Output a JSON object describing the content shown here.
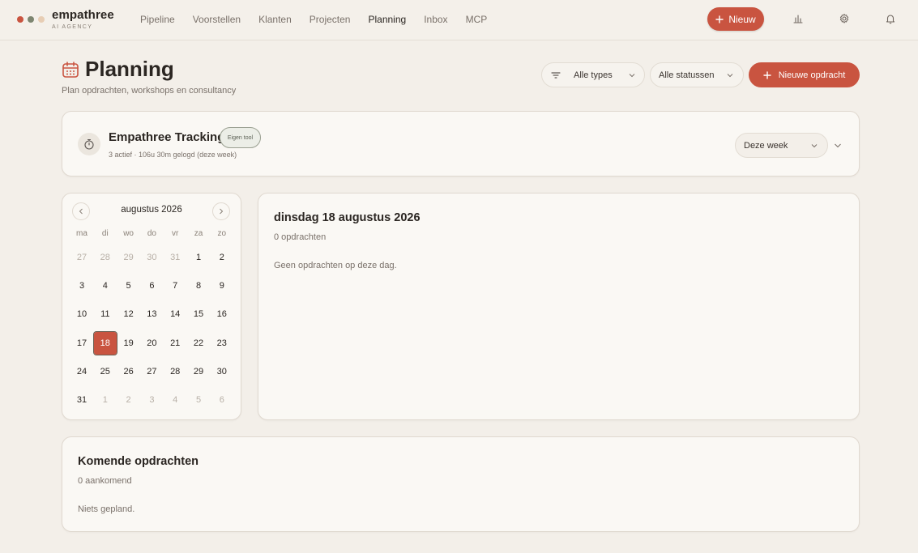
{
  "brand": {
    "name": "empathree",
    "subtitle": "AI AGENCY",
    "dot_colors": [
      "#c95440",
      "#7d8570",
      "#e7cdb4"
    ]
  },
  "nav": {
    "items": [
      {
        "label": "Pipeline",
        "active": false
      },
      {
        "label": "Voorstellen",
        "active": false
      },
      {
        "label": "Klanten",
        "active": false
      },
      {
        "label": "Projecten",
        "active": false
      },
      {
        "label": "Planning",
        "active": true
      },
      {
        "label": "Inbox",
        "active": false
      },
      {
        "label": "MCP",
        "active": false
      }
    ],
    "new_button": "Nieuw",
    "icons": [
      "chart-icon",
      "gear-icon",
      "bell-icon"
    ]
  },
  "header": {
    "title": "Planning",
    "subtitle": "Plan opdrachten, workshops en consultancy",
    "filter_types": "Alle types",
    "filter_status": "Alle statussen",
    "new_assignment": "Nieuwe opdracht"
  },
  "tracking": {
    "title": "Empathree Tracking",
    "badge": "Eigen tool",
    "summary": "3 actief · 106u 30m gelogd (deze week)",
    "period": "Deze week"
  },
  "calendar": {
    "month_label": "augustus 2026",
    "weekdays": [
      "ma",
      "di",
      "wo",
      "do",
      "vr",
      "za",
      "zo"
    ],
    "weeks": [
      [
        {
          "d": "27",
          "m": true
        },
        {
          "d": "28",
          "m": true
        },
        {
          "d": "29",
          "m": true
        },
        {
          "d": "30",
          "m": true
        },
        {
          "d": "31",
          "m": true
        },
        {
          "d": "1"
        },
        {
          "d": "2"
        }
      ],
      [
        {
          "d": "3"
        },
        {
          "d": "4"
        },
        {
          "d": "5"
        },
        {
          "d": "6"
        },
        {
          "d": "7"
        },
        {
          "d": "8"
        },
        {
          "d": "9"
        }
      ],
      [
        {
          "d": "10"
        },
        {
          "d": "11"
        },
        {
          "d": "12"
        },
        {
          "d": "13"
        },
        {
          "d": "14"
        },
        {
          "d": "15"
        },
        {
          "d": "16"
        }
      ],
      [
        {
          "d": "17"
        },
        {
          "d": "18",
          "s": true
        },
        {
          "d": "19"
        },
        {
          "d": "20"
        },
        {
          "d": "21"
        },
        {
          "d": "22"
        },
        {
          "d": "23"
        }
      ],
      [
        {
          "d": "24"
        },
        {
          "d": "25"
        },
        {
          "d": "26"
        },
        {
          "d": "27"
        },
        {
          "d": "28"
        },
        {
          "d": "29"
        },
        {
          "d": "30"
        }
      ],
      [
        {
          "d": "31"
        },
        {
          "d": "1",
          "m": true
        },
        {
          "d": "2",
          "m": true
        },
        {
          "d": "3",
          "m": true
        },
        {
          "d": "4",
          "m": true
        },
        {
          "d": "5",
          "m": true
        },
        {
          "d": "6",
          "m": true
        }
      ]
    ]
  },
  "day_panel": {
    "title": "dinsdag 18 augustus 2026",
    "count": "0 opdrachten",
    "empty": "Geen opdrachten op deze dag."
  },
  "upcoming": {
    "title": "Komende opdrachten",
    "count": "0 aankomend",
    "empty": "Niets gepland."
  },
  "colors": {
    "accent": "#c95440",
    "background": "#f3efe9",
    "card": "#faf8f4"
  }
}
